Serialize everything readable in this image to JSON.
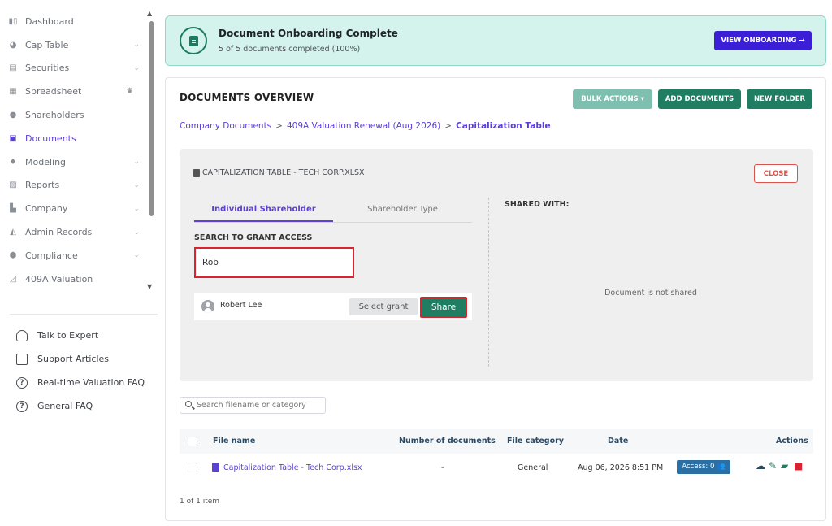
{
  "sidebar": {
    "items": [
      {
        "label": "Dashboard",
        "icon": "dashboard-icon",
        "chevron": false
      },
      {
        "label": "Cap Table",
        "icon": "pie-chart-icon",
        "chevron": true
      },
      {
        "label": "Securities",
        "icon": "clipboard-icon",
        "chevron": true
      },
      {
        "label": "Spreadsheet",
        "icon": "table-icon",
        "chevron": false,
        "crown": true
      },
      {
        "label": "Shareholders",
        "icon": "user-icon",
        "chevron": false
      },
      {
        "label": "Documents",
        "icon": "folder-icon",
        "chevron": false,
        "active": true
      },
      {
        "label": "Modeling",
        "icon": "bulb-icon",
        "chevron": true
      },
      {
        "label": "Reports",
        "icon": "report-icon",
        "chevron": true
      },
      {
        "label": "Company",
        "icon": "building-icon",
        "chevron": true
      },
      {
        "label": "Admin Records",
        "icon": "admin-icon",
        "chevron": true
      },
      {
        "label": "Compliance",
        "icon": "shield-icon",
        "chevron": true
      },
      {
        "label": "409A Valuation",
        "icon": "valuation-icon",
        "chevron": false
      }
    ],
    "help": [
      {
        "label": "Talk to Expert",
        "icon": "headphones-icon"
      },
      {
        "label": "Support Articles",
        "icon": "book-icon"
      },
      {
        "label": "Real-time Valuation FAQ",
        "icon": "help-circle-icon"
      },
      {
        "label": "General FAQ",
        "icon": "help-circle-icon"
      }
    ]
  },
  "banner": {
    "title": "Document Onboarding Complete",
    "subtitle": "5 of 5 documents completed (100%)",
    "button": "VIEW ONBOARDING →",
    "progress_percent": 100
  },
  "overview": {
    "title": "DOCUMENTS OVERVIEW",
    "bulk_actions": "BULK ACTIONS ▾",
    "add_documents": "ADD DOCUMENTS",
    "new_folder": "NEW FOLDER",
    "breadcrumb": [
      "Company Documents",
      "409A Valuation Renewal (Aug 2026)",
      "Capitalization Table"
    ],
    "breadcrumb_sep": ">"
  },
  "share_panel": {
    "file_name": "CAPITALIZATION TABLE - TECH CORP.XLSX",
    "close": "CLOSE",
    "tabs": [
      "Individual Shareholder",
      "Shareholder Type"
    ],
    "active_tab": 0,
    "grant_label": "SEARCH TO GRANT ACCESS",
    "search_value": "Rob",
    "result_name": "Robert Lee",
    "select_grant": "Select grant",
    "share_button": "Share",
    "shared_with_label": "SHARED WITH:",
    "not_shared": "Document is not shared"
  },
  "files": {
    "search_placeholder": "Search filename or category",
    "columns": [
      "File name",
      "Number of documents",
      "File category",
      "Date",
      "Actions"
    ],
    "rows": [
      {
        "name": "Capitalization Table - Tech Corp.xlsx",
        "count": "-",
        "category": "General",
        "date": "Aug 06, 2026 8:51 PM",
        "access": "Access: 0 👥"
      }
    ],
    "pager": "1 of 1 item"
  },
  "colors": {
    "accent": "#5d3fd3",
    "primary_green": "#1f7e62",
    "banner_bg": "#d3f3ec",
    "danger": "#d9534f",
    "onboard_button": "#3a1fd6"
  }
}
